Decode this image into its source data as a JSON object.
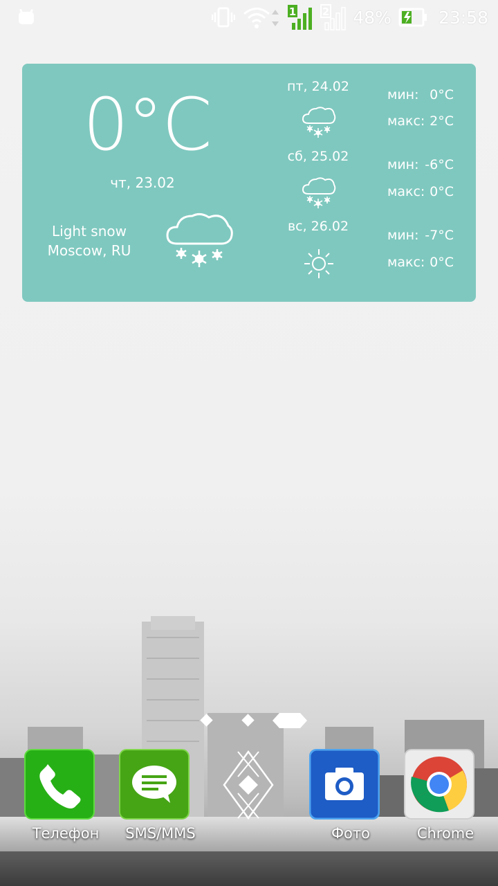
{
  "status_bar": {
    "battery": "48%",
    "time": "23:58",
    "sim1_label": "1",
    "sim2_label": "2",
    "icons": [
      "android-notification-icon",
      "vibrate-icon",
      "wifi-icon",
      "sim1-signal-icon",
      "sim2-signal-icon",
      "battery-charging-icon"
    ]
  },
  "weather": {
    "current": {
      "temp": "0°C",
      "date": "чт, 23.02",
      "condition": "Light snow",
      "location": "Moscow, RU",
      "icon": "snow-cloud-icon"
    },
    "forecast": [
      {
        "day": "пт, 24.02",
        "min_label": "мин:",
        "min": "0°C",
        "max_label": "макс:",
        "max": "2°C",
        "icon": "snow-cloud-icon"
      },
      {
        "day": "сб, 25.02",
        "min_label": "мин:",
        "min": "-6°C",
        "max_label": "макс:",
        "max": "0°C",
        "icon": "snow-cloud-icon"
      },
      {
        "day": "вс, 26.02",
        "min_label": "мин:",
        "min": "-7°C",
        "max_label": "макс:",
        "max": "0°C",
        "icon": "sun-icon"
      }
    ],
    "background_color": "#7fc8bf"
  },
  "pager": {
    "pages": 3,
    "active": 3
  },
  "dock": {
    "apps": [
      {
        "label": "Телефон",
        "icon": "phone-icon",
        "color": "#2bb51a"
      },
      {
        "label": "SMS/MMS",
        "icon": "sms-icon",
        "color": "#4caf18"
      },
      {
        "label": "",
        "icon": "app-drawer-icon",
        "color": ""
      },
      {
        "label": "Фото",
        "icon": "camera-icon",
        "color": "#1f5fc8"
      },
      {
        "label": "Chrome",
        "icon": "chrome-icon",
        "color": "#e8e8e8"
      }
    ]
  }
}
